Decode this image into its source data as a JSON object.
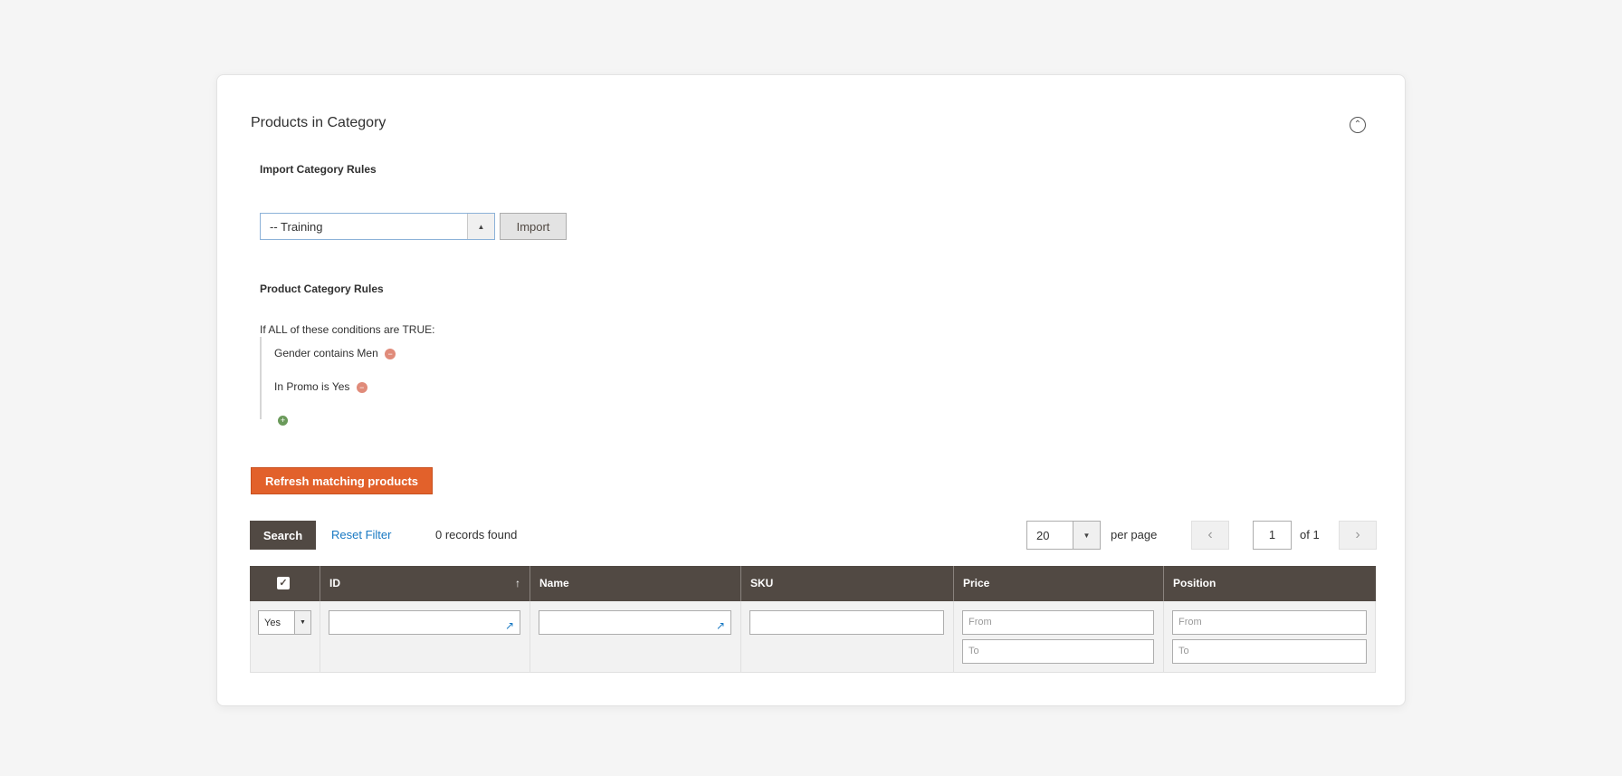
{
  "section": {
    "title": "Products in Category",
    "collapse_icon": "chevron-up-circle-icon"
  },
  "import_rules": {
    "heading": "Import Category Rules",
    "selected_value": "-- Training",
    "import_label": "Import"
  },
  "category_rules": {
    "heading": "Product Category Rules",
    "condition_intro": {
      "prefix": "If",
      "aggregator": "ALL",
      "middle": "of these conditions are",
      "value": "TRUE",
      "suffix": ":"
    },
    "conditions": [
      {
        "attribute": "Gender",
        "operator": "contains",
        "value": "Men"
      },
      {
        "attribute": "In Promo",
        "operator": "is",
        "value": "Yes"
      }
    ]
  },
  "actions": {
    "refresh_label": "Refresh matching products"
  },
  "grid_toolbar": {
    "search_label": "Search",
    "reset_label": "Reset Filter",
    "records_text": "0 records found",
    "per_page_value": "20",
    "per_page_label": "per page",
    "page_value": "1",
    "page_of": "of 1"
  },
  "grid": {
    "columns": [
      "ID",
      "Name",
      "SKU",
      "Price",
      "Position"
    ],
    "filters": {
      "in_category_value": "Yes",
      "price_from_placeholder": "From",
      "price_to_placeholder": "To",
      "position_from_placeholder": "From",
      "position_to_placeholder": "To"
    }
  },
  "colors": {
    "accent": "#e2612b",
    "header_bg": "#514943",
    "link": "#1979c3"
  }
}
